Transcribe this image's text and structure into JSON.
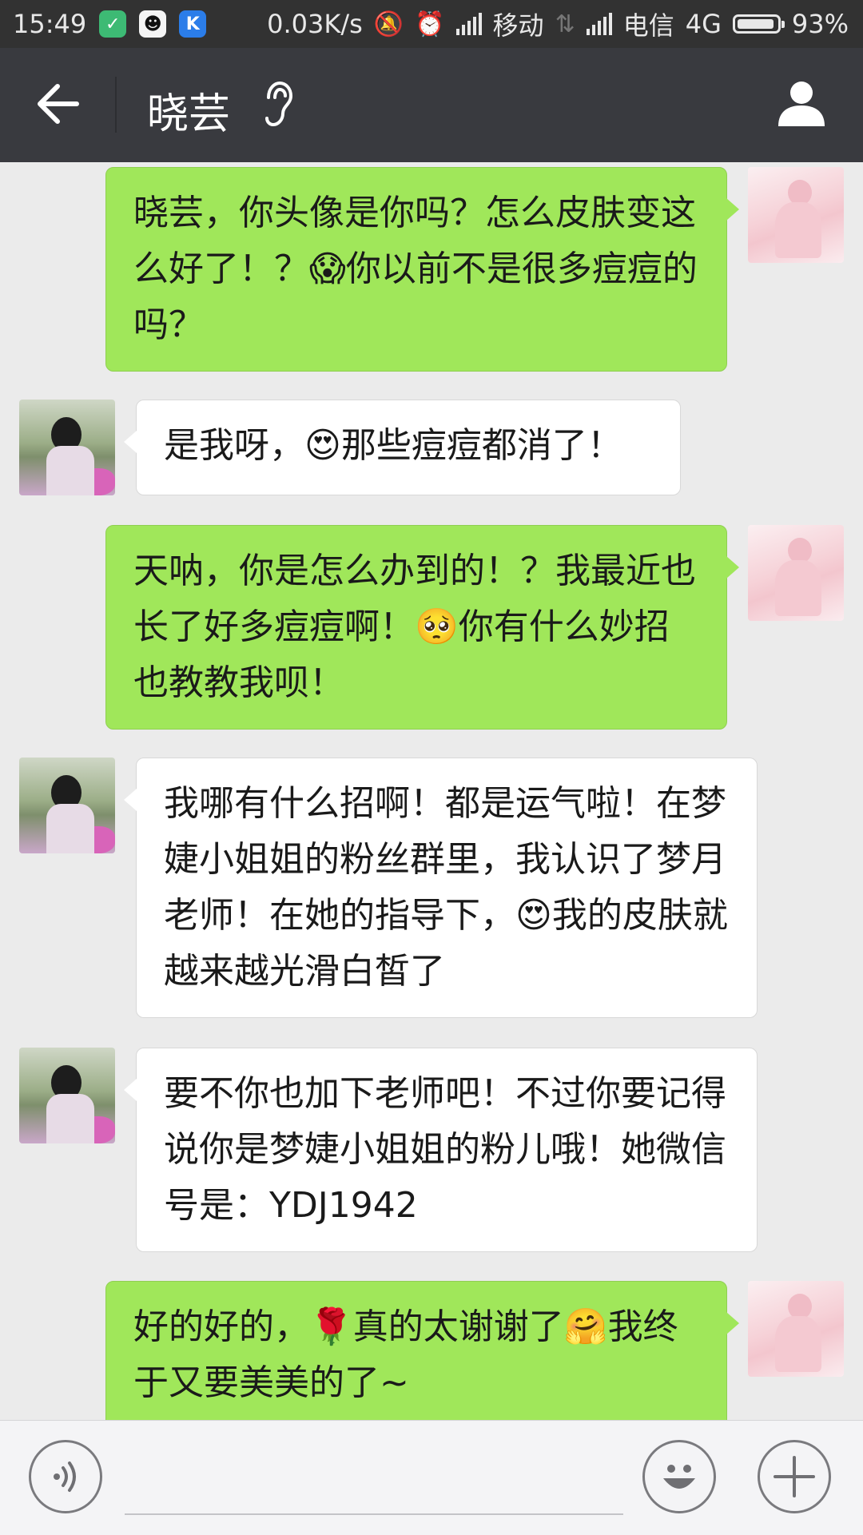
{
  "status_bar": {
    "time": "15:49",
    "speed": "0.03K/s",
    "carrier1": "移动",
    "carrier2": "电信",
    "network": "4G",
    "battery": "93%",
    "battery_level": 0.93,
    "icons": [
      "shield-app-icon",
      "qq-icon",
      "k-app-icon",
      "mute-icon",
      "alarm-icon",
      "signal-icon",
      "data-arrows-icon",
      "signal-icon",
      "battery-icon"
    ]
  },
  "header": {
    "title": "晓芸",
    "icons": [
      "back-arrow-icon",
      "earpiece-icon",
      "person-icon"
    ]
  },
  "messages": [
    {
      "sender": "me",
      "text": "晓芸，你头像是你吗？怎么皮肤变这么好了！？😱你以前不是很多痘痘的吗？"
    },
    {
      "sender": "her",
      "text": "是我呀，😍那些痘痘都消了！"
    },
    {
      "sender": "me",
      "text": "天呐，你是怎么办到的！？我最近也长了好多痘痘啊！🥺你有什么妙招也教教我呗！"
    },
    {
      "sender": "her",
      "text": "我哪有什么招啊！都是运气啦！在梦婕小姐姐的粉丝群里，我认识了梦月老师！在她的指导下，😍我的皮肤就越来越光滑白皙了"
    },
    {
      "sender": "her",
      "text": "要不你也加下老师吧！不过你要记得说你是梦婕小姐姐的粉儿哦！她微信号是：YDJ1942"
    },
    {
      "sender": "me",
      "text": "好的好的，🌹真的太谢谢了🤗我终于又要美美的了~"
    }
  ],
  "input_bar": {
    "icons": [
      "voice-icon",
      "emoji-icon",
      "plus-icon"
    ]
  },
  "colors": {
    "status_bg": "#323232",
    "header_bg": "#393a3f",
    "chat_bg": "#ebebeb",
    "my_bubble": "#a0e75a",
    "her_bubble": "#ffffff"
  }
}
